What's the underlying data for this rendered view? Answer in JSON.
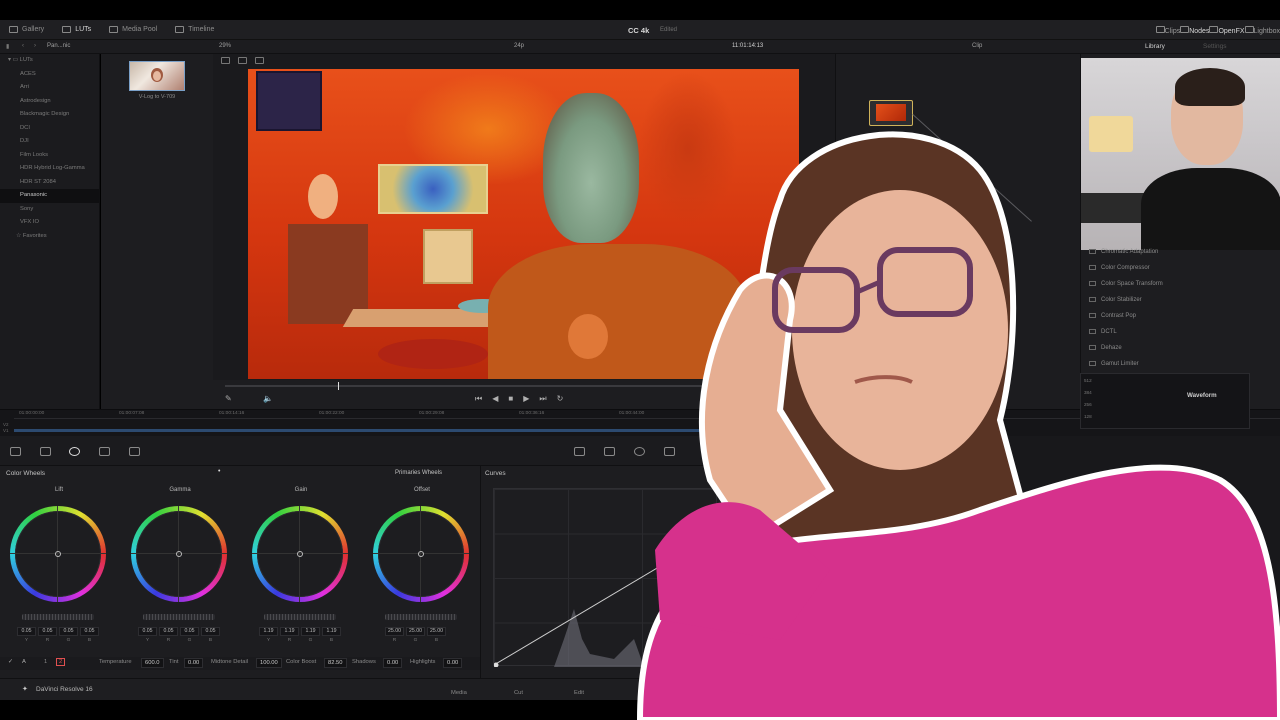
{
  "header": {
    "tabs": [
      {
        "label": "Gallery"
      },
      {
        "label": "LUTs"
      },
      {
        "label": "Media Pool"
      },
      {
        "label": "Timeline"
      }
    ],
    "project_title": "CC 4k",
    "project_status": "Edited",
    "right_tabs": [
      {
        "label": "Clips"
      },
      {
        "label": "Nodes"
      },
      {
        "label": "OpenFX"
      },
      {
        "label": "Lightbox"
      }
    ]
  },
  "subbar": {
    "folder": "Pan...nic",
    "zoom": "29%",
    "fps": "24p",
    "timecode": "11:01:14:13",
    "mode": "Clip"
  },
  "lut_tree": {
    "root": "LUTs",
    "items": [
      "ACES",
      "Arri",
      "Astrodesign",
      "Blackmagic Design",
      "DCI",
      "DJI",
      "Film Looks",
      "HDR Hybrid Log-Gamma",
      "HDR ST 2084",
      "Panasonic",
      "Sony",
      "VFX IO"
    ],
    "selected": "Panasonic",
    "favorites": "Favorites"
  },
  "lut_grid": {
    "thumb_label": "V-Log to V-709"
  },
  "library": {
    "tab_library": "Library",
    "tab_settings": "Settings",
    "items": [
      "Chromatic Adaptation",
      "Color Compressor",
      "Color Space Transform",
      "Color Stabilizer",
      "Contrast Pop",
      "DCTL",
      "Dehaze",
      "Gamut Limiter"
    ]
  },
  "timeline": {
    "ticks": [
      "01:00:00:00",
      "01:00:07:08",
      "01:00:14:16",
      "01:00:22:00",
      "01:00:29:08",
      "01:00:36:16",
      "01:00:44:00"
    ],
    "tracks": [
      "V2",
      "V1"
    ]
  },
  "color_wheels": {
    "title": "Color Wheels",
    "mode": "Primaries Wheels",
    "wheels": [
      {
        "name": "Lift",
        "values": [
          "0.05",
          "0.05",
          "0.05",
          "0.05"
        ]
      },
      {
        "name": "Gamma",
        "values": [
          "0.05",
          "0.05",
          "0.05",
          "0.05"
        ]
      },
      {
        "name": "Gain",
        "values": [
          "1.19",
          "1.19",
          "1.19",
          "1.19"
        ]
      },
      {
        "name": "Offset",
        "values": [
          "25.00",
          "25.00",
          "25.00"
        ]
      }
    ],
    "channels4": [
      "Y",
      "R",
      "G",
      "B"
    ],
    "channels3": [
      "R",
      "G",
      "B"
    ]
  },
  "params": {
    "page1": "1",
    "page2": "2",
    "temperature_label": "Temperature",
    "temperature": "600.0",
    "tint_label": "Tint",
    "tint": "0.00",
    "midtone_label": "Midtone Detail",
    "midtone": "100.00",
    "boost_label": "Color Boost",
    "boost": "82.50",
    "shadows_label": "Shadows",
    "shadows": "0.00",
    "highlights_label": "Highlights",
    "highlights": "0.00"
  },
  "curves": {
    "title": "Curves"
  },
  "scope": {
    "title": "Waveform",
    "ticks": [
      "512",
      "384",
      "256",
      "128"
    ]
  },
  "page_bar": {
    "app_name": "DaVinci Resolve 16",
    "pages": [
      "Media",
      "Cut",
      "Edit"
    ]
  },
  "colors": {
    "panel_bg": "#1d1d20",
    "accent_selected": "#cfb35a",
    "shirt_pink": "#d6318c"
  }
}
